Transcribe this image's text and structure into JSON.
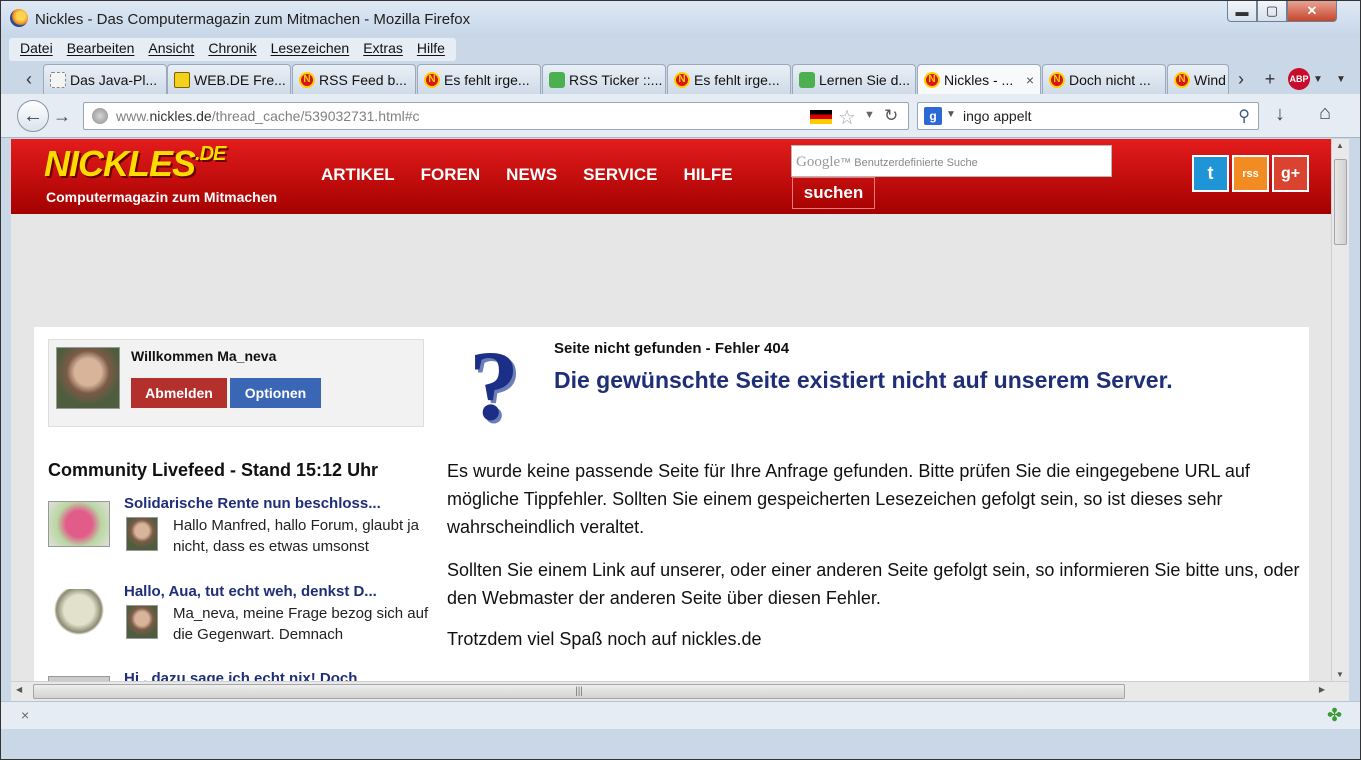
{
  "window": {
    "title": "Nickles - Das Computermagazin zum Mitmachen - Mozilla Firefox",
    "controls": {
      "minimize": "▬",
      "maximize": "▢",
      "close": "✕"
    }
  },
  "menu": [
    "Datei",
    "Bearbeiten",
    "Ansicht",
    "Chronik",
    "Lesezeichen",
    "Extras",
    "Hilfe"
  ],
  "tabs": [
    {
      "label": "Das Java-Pl...",
      "icon": "empty-page-icon",
      "active": false
    },
    {
      "label": "WEB.DE Fre...",
      "icon": "webde-icon",
      "active": false
    },
    {
      "label": "RSS Feed b...",
      "icon": "nickles-icon",
      "active": false
    },
    {
      "label": "Es fehlt irge...",
      "icon": "nickles-icon",
      "active": false
    },
    {
      "label": "RSS Ticker ::...",
      "icon": "puzzle-icon",
      "active": false
    },
    {
      "label": "Es fehlt irge...",
      "icon": "nickles-icon",
      "active": false
    },
    {
      "label": "Lernen Sie d...",
      "icon": "puzzle-icon",
      "active": false
    },
    {
      "label": "Nickles - ...",
      "icon": "nickles-icon",
      "active": true
    },
    {
      "label": "Doch nicht ...",
      "icon": "nickles-icon",
      "active": false
    },
    {
      "label": "Wind",
      "icon": "nickles-icon",
      "active": false
    }
  ],
  "tab_extras": {
    "new_tab": "+",
    "abp": "ABP"
  },
  "navbar": {
    "url_prefix": "www.",
    "url_domain": "nickles.de",
    "url_path": "/thread_cache/539032731.html#c",
    "search_engine": "g",
    "search_value": "ingo appelt"
  },
  "site": {
    "logo_main": "NICKLES",
    "logo_suffix": ".DE",
    "tagline": "Computermagazin zum Mitmachen",
    "nav": [
      "ARTIKEL",
      "FOREN",
      "NEWS",
      "SERVICE",
      "HILFE"
    ],
    "search_brand": "Google",
    "search_placeholder": "Benutzerdefinierte Suche",
    "search_button": "suchen",
    "social": {
      "twitter": "t",
      "rss": "rss",
      "gplus": "g+"
    }
  },
  "user": {
    "welcome": "Willkommen Ma_neva",
    "logout": "Abmelden",
    "options": "Optionen"
  },
  "feed": {
    "title": "Community Livefeed - Stand 15:12 Uhr",
    "items": [
      {
        "title": "Solidarische Rente nun beschloss...",
        "text": "Hallo Manfred, hallo Forum, glaubt ja nicht, dass es etwas umsonst"
      },
      {
        "title": "Hallo, Aua, tut echt weh, denkst D...",
        "text": "Ma_neva, meine Frage bezog sich auf die Gegenwart. Demnach"
      },
      {
        "title": "Hi , dazu sage ich echt nix! Doch",
        "text": ""
      }
    ]
  },
  "error": {
    "code_line": "Seite nicht gefunden - Fehler 404",
    "headline": "Die gewünschte Seite existiert nicht auf unserem Server.",
    "para1": "Es wurde keine passende Seite für Ihre Anfrage gefunden. Bitte prüfen Sie die eingegebene URL auf mögliche Tippfehler. Sollten Sie einem gespeicherten Lesezeichen gefolgt sein, so ist dieses sehr wahrscheindlich veraltet.",
    "para2": "Sollten Sie einem Link auf unserer, oder einer anderen Seite gefolgt sein, so informieren Sie bitte uns, oder den Webmaster der anderen Seite über diesen Fehler.",
    "para3": "Trotzdem viel Spaß noch auf nickles.de"
  },
  "icons": {
    "back": "←",
    "forward": "→",
    "reload": "↻",
    "star": "☆",
    "download": "↓",
    "home": "⌂",
    "magnifier": "⚲",
    "close": "×",
    "puzzle": "✤"
  }
}
